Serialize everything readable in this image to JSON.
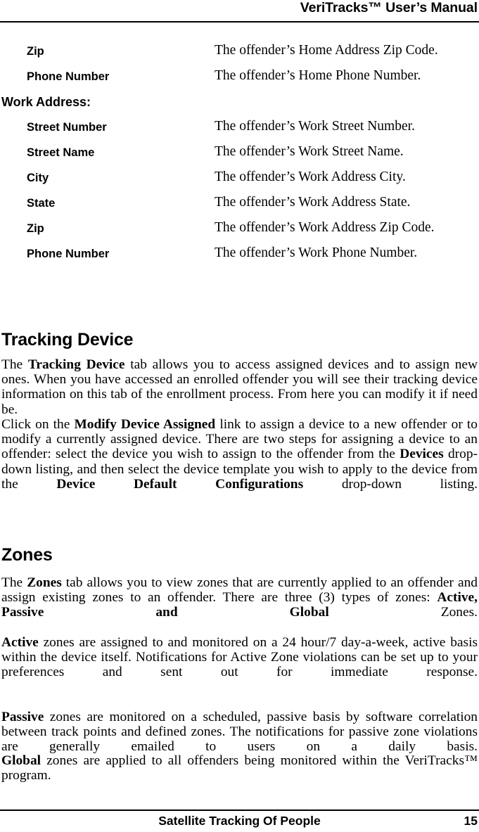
{
  "header": {
    "title": "VeriTracks™ User’s Manual"
  },
  "footer": {
    "organization": "Satellite Tracking Of People",
    "page_number": "15"
  },
  "field_definitions": [
    {
      "kind": "term",
      "term": "Zip",
      "description": "The offender’s Home Address Zip Code."
    },
    {
      "kind": "term",
      "term": "Phone Number",
      "description": "The offender’s Home Phone Number."
    },
    {
      "kind": "section",
      "term": "Work Address:",
      "description": ""
    },
    {
      "kind": "term",
      "term": "Street Number",
      "description": "The offender’s Work Street Number."
    },
    {
      "kind": "term",
      "term": "Street Name",
      "description": "The offender’s Work Street Name."
    },
    {
      "kind": "term",
      "term": "City",
      "description": "The offender’s Work Address City."
    },
    {
      "kind": "term",
      "term": "State",
      "description": "The offender’s Work Address State."
    },
    {
      "kind": "term",
      "term": "Zip",
      "description": "The offender’s Work Address Zip Code."
    },
    {
      "kind": "term",
      "term": "Phone Number",
      "description": "The offender’s Work Phone Number."
    }
  ],
  "sections": {
    "tracking_device": {
      "heading": "Tracking Device",
      "paragraphs": [
        {
          "runs": [
            {
              "text": "The ",
              "bold": false
            },
            {
              "text": "Tracking Device",
              "bold": true
            },
            {
              "text": " tab allows you to access assigned devices and to assign new ones.  When you have accessed an enrolled offender you will see their tracking device information on this tab of the enrollment process.  From here you can modify it if need be.",
              "bold": false
            }
          ]
        },
        {
          "runs": [
            {
              "text": "Click on the ",
              "bold": false
            },
            {
              "text": "Modify Device Assigned",
              "bold": true
            },
            {
              "text": " link to assign a device to a new offender or to modify a currently assigned device.  There are two steps for assigning a device to an offender:  select the device you wish to assign to the offender from the ",
              "bold": false
            },
            {
              "text": "Devices",
              "bold": true
            },
            {
              "text": " drop-down listing, and then select the device template you wish to apply to the device from the ",
              "bold": false
            },
            {
              "text": "Device Default Configurations",
              "bold": true
            },
            {
              "text": " drop-down listing.",
              "bold": false
            }
          ]
        }
      ]
    },
    "zones": {
      "heading": "Zones",
      "paragraphs": [
        {
          "runs": [
            {
              "text": "The ",
              "bold": false
            },
            {
              "text": "Zones",
              "bold": true
            },
            {
              "text": " tab allows you to view zones that are currently applied to an offender and assign existing zones to an offender.  There are three (3) types of zones: ",
              "bold": false
            },
            {
              "text": "Active, Passive and Global",
              "bold": true
            },
            {
              "text": " Zones.",
              "bold": false
            }
          ]
        },
        {
          "runs": [
            {
              "text": "Active",
              "bold": true
            },
            {
              "text": " zones are assigned to and monitored on a 24 hour/7 day-a-week, active basis within the device itself.  Notifications for Active Zone violations can be set up to your preferences and sent out for immediate response.",
              "bold": false
            }
          ]
        },
        {
          "runs": [
            {
              "text": "Passive",
              "bold": true
            },
            {
              "text": " zones are monitored on a scheduled, passive basis by software correlation between track points and defined zones. The notifications for passive zone violations are generally emailed to users on a daily basis.",
              "bold": false
            }
          ]
        },
        {
          "runs": [
            {
              "text": "Global",
              "bold": true
            },
            {
              "text": " zones are applied to all offenders being monitored within the VeriTracks™ program.",
              "bold": false
            }
          ]
        }
      ]
    }
  }
}
